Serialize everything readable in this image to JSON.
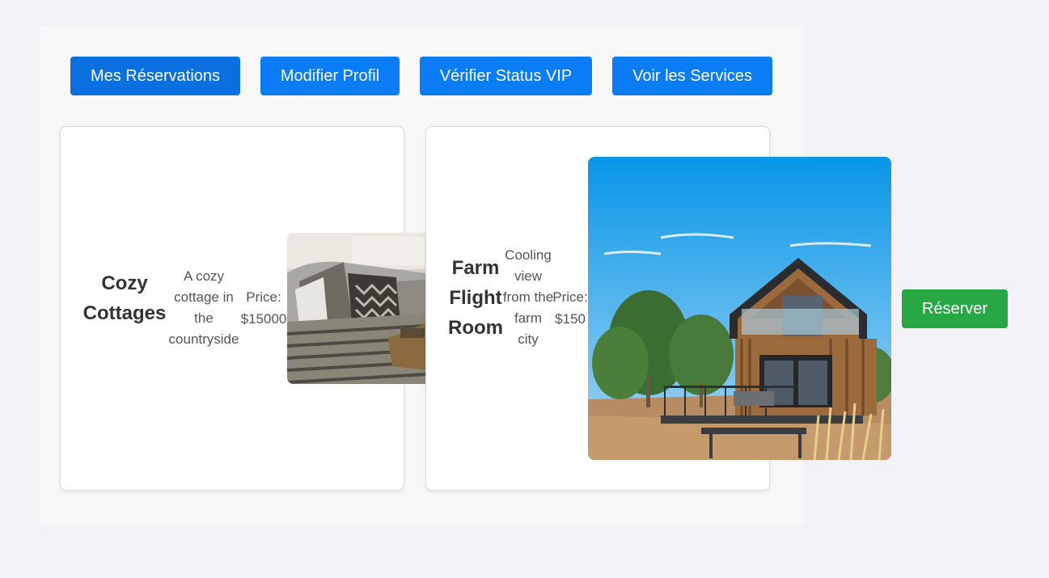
{
  "nav": {
    "buttons": [
      {
        "label": "Mes Réservations"
      },
      {
        "label": "Modifier Profil"
      },
      {
        "label": "Vérifier Status VIP"
      },
      {
        "label": "Voir les Services"
      }
    ]
  },
  "listings": [
    {
      "title": "Cozy Cottages",
      "description": "A cozy cottage in the countryside",
      "price": "Price: $15000",
      "image": "bedroom-photo"
    },
    {
      "title": "Farm Flight Room",
      "description": "Cooling view from the farm city",
      "price": "Price: $150",
      "image": "cabin-photo"
    }
  ],
  "reserve_button": {
    "label": "Réserver"
  },
  "colors": {
    "primary": "#0a7cf5",
    "success": "#28a745",
    "background": "#f3f3f7"
  }
}
